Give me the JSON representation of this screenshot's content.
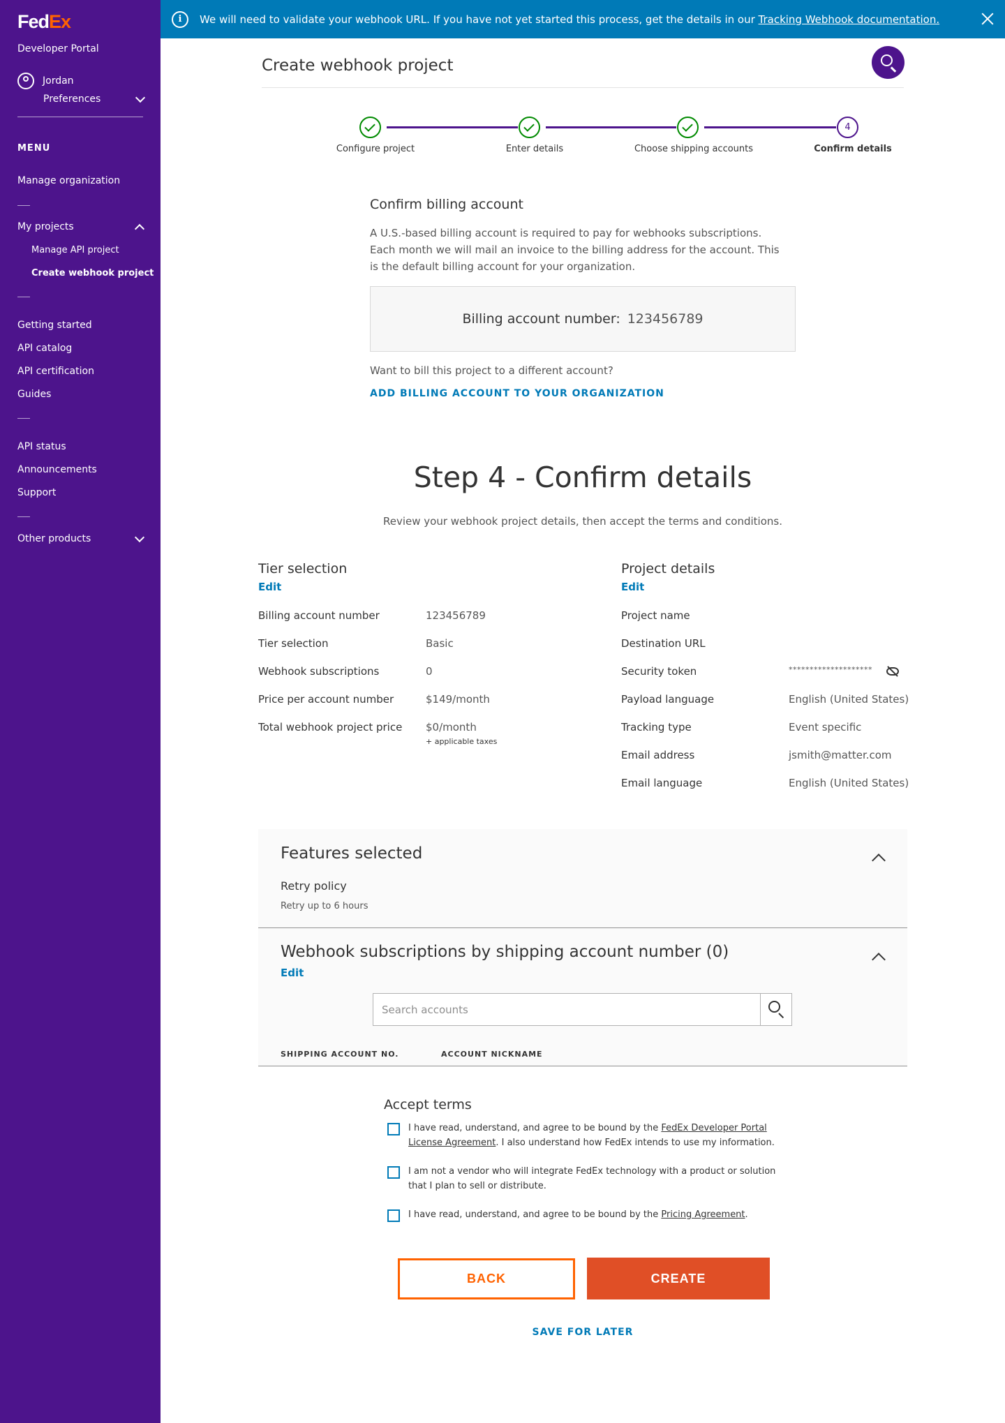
{
  "sidebar": {
    "logo_fed": "Fed",
    "logo_ex": "Ex",
    "portal_label": "Developer Portal",
    "user_name": "Jordan",
    "preferences_label": "Preferences",
    "menu_title": "MENU",
    "manage_org": "Manage organization",
    "my_projects": "My projects",
    "manage_api_project": "Manage API project",
    "create_webhook_project": "Create webhook project",
    "getting_started": "Getting started",
    "api_catalog": "API catalog",
    "api_certification": "API certification",
    "guides": "Guides",
    "api_status": "API status",
    "announcements": "Announcements",
    "support": "Support",
    "other_products": "Other products",
    "brand_color": "#4d148c"
  },
  "banner": {
    "text": "We will need to validate your webhook URL. If you have not yet started this process, get the details in our ",
    "link_text": "Tracking Webhook documentation.",
    "color": "#007ab7"
  },
  "header": {
    "title": "Create webhook project"
  },
  "stepper": {
    "steps": [
      {
        "label": "Configure project"
      },
      {
        "label": "Enter details"
      },
      {
        "label": "Choose shipping accounts"
      },
      {
        "label": "Confirm details",
        "number": "4"
      }
    ]
  },
  "billing": {
    "title": "Confirm billing account",
    "description": "A U.S.-based billing account is required to pay for webhooks subscriptions. Each month we will mail an invoice to the billing address for the account. This is the default billing account for your organization.",
    "account_label": "Billing account number:",
    "account_number": "123456789",
    "different_question": "Want to bill this project to a different account?",
    "add_link": "ADD BILLING ACCOUNT TO YOUR ORGANIZATION"
  },
  "step4": {
    "title": "Step 4 - Confirm details",
    "subtitle": "Review your webhook project details, then accept the terms and conditions."
  },
  "tier": {
    "title": "Tier selection",
    "edit": "Edit",
    "rows": [
      {
        "label": "Billing account number",
        "value": "123456789"
      },
      {
        "label": "Tier selection",
        "value": "Basic"
      },
      {
        "label": "Webhook subscriptions",
        "value": "0"
      },
      {
        "label": "Price per account number",
        "value": "$149/month"
      },
      {
        "label": "Total webhook project price",
        "value": "$0/month"
      }
    ],
    "taxes_note": "+ applicable taxes"
  },
  "project": {
    "title": "Project details",
    "edit": "Edit",
    "rows": [
      {
        "label": "Project name",
        "value": ""
      },
      {
        "label": "Destination URL",
        "value": ""
      },
      {
        "label": "Security token",
        "value": "********************"
      },
      {
        "label": "Payload language",
        "value": "English (United States)"
      },
      {
        "label": "Tracking type",
        "value": "Event specific"
      },
      {
        "label": "Email address",
        "value": "jsmith@matter.com"
      },
      {
        "label": "Email language",
        "value": "English (United States)"
      }
    ]
  },
  "features": {
    "title": "Features selected",
    "retry_label": "Retry policy",
    "retry_value": "Retry up to 6 hours"
  },
  "subscriptions": {
    "title": "Webhook subscriptions by shipping account number (0)",
    "edit": "Edit",
    "search_placeholder": "Search accounts",
    "col_account": "SHIPPING ACCOUNT NO.",
    "col_nickname": "ACCOUNT NICKNAME"
  },
  "terms": {
    "title": "Accept terms",
    "t1_pre": "I have read, understand, and agree to be bound by the ",
    "t1_link": "FedEx Developer Portal License Agreement",
    "t1_post": ". I also understand how FedEx intends to use my information.",
    "t2": "I am not a vendor who will integrate FedEx technology with a product or solution that I plan to sell or distribute.",
    "t3_pre": "I have read, understand, and agree to be bound by the ",
    "t3_link": "Pricing Agreement",
    "t3_post": "."
  },
  "actions": {
    "back": "BACK",
    "create": "CREATE",
    "save_later": "SAVE FOR LATER",
    "accent_color": "#ff6200",
    "link_color": "#007ab7"
  }
}
